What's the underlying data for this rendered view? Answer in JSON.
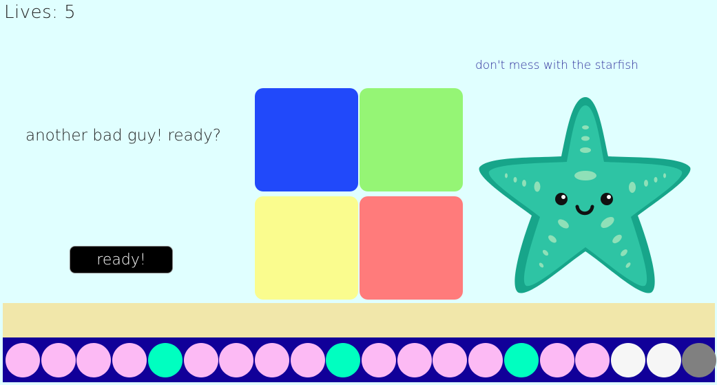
{
  "hud": {
    "lives_text": "Lives: 5"
  },
  "message": "another bad guy! ready?",
  "ready_button": "ready!",
  "enemy": {
    "caption": "don't mess with the starfish",
    "icon": "starfish-icon"
  },
  "pads": [
    {
      "name": "blue",
      "color": "#2149fa"
    },
    {
      "name": "green",
      "color": "#95f575"
    },
    {
      "name": "yellow",
      "color": "#fafc8e"
    },
    {
      "name": "red",
      "color": "#ff7b7b"
    }
  ],
  "progress_dots": [
    {
      "state": "pending",
      "color": "#fcbaf4"
    },
    {
      "state": "pending",
      "color": "#fcbaf4"
    },
    {
      "state": "pending",
      "color": "#fcbaf4"
    },
    {
      "state": "pending",
      "color": "#fcbaf4"
    },
    {
      "state": "enemy",
      "color": "#00ffc0"
    },
    {
      "state": "pending",
      "color": "#fcbaf4"
    },
    {
      "state": "pending",
      "color": "#fcbaf4"
    },
    {
      "state": "pending",
      "color": "#fcbaf4"
    },
    {
      "state": "pending",
      "color": "#fcbaf4"
    },
    {
      "state": "enemy",
      "color": "#00ffc0"
    },
    {
      "state": "pending",
      "color": "#fcbaf4"
    },
    {
      "state": "pending",
      "color": "#fcbaf4"
    },
    {
      "state": "pending",
      "color": "#fcbaf4"
    },
    {
      "state": "pending",
      "color": "#fcbaf4"
    },
    {
      "state": "enemy",
      "color": "#00ffc0"
    },
    {
      "state": "pending",
      "color": "#fcbaf4"
    },
    {
      "state": "pending",
      "color": "#fcbaf4"
    },
    {
      "state": "empty",
      "color": "#f6f6f6"
    },
    {
      "state": "empty",
      "color": "#f6f6f6"
    },
    {
      "state": "current",
      "color": "#808080"
    }
  ],
  "colors": {
    "background": "#e0ffff",
    "sand": "#f1e7aa",
    "track": "#110099",
    "caption": "#2b2b99"
  }
}
